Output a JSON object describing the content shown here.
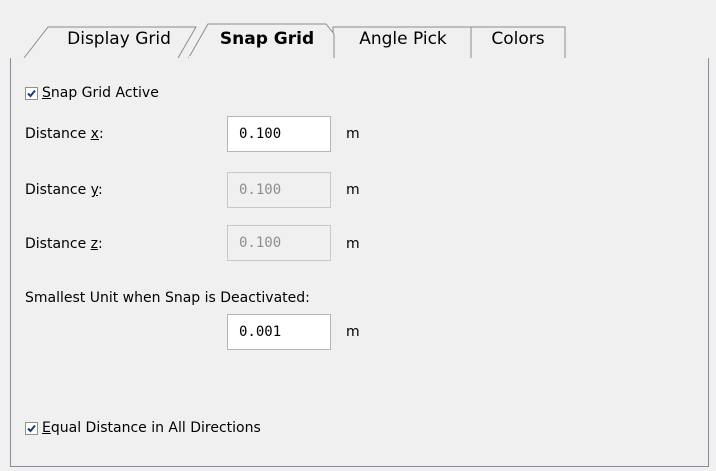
{
  "tabs": [
    {
      "label": "Display Grid",
      "active": false
    },
    {
      "label": "Snap Grid",
      "active": true
    },
    {
      "label": "Angle Pick",
      "active": false
    },
    {
      "label": "Colors",
      "active": false
    }
  ],
  "snap_grid_active": {
    "label_mnemonic": "S",
    "label_rest": "nap Grid Active",
    "checked": true
  },
  "distance_x": {
    "label_prefix": "Distance ",
    "mnemonic": "x",
    "label_suffix": ":",
    "value": "0.100",
    "unit": "m",
    "enabled": true
  },
  "distance_y": {
    "label_prefix": "Distance ",
    "mnemonic": "y",
    "label_suffix": ":",
    "value": "0.100",
    "unit": "m",
    "enabled": false
  },
  "distance_z": {
    "label_prefix": "Distance ",
    "mnemonic": "z",
    "label_suffix": ":",
    "value": "0.100",
    "unit": "m",
    "enabled": false
  },
  "smallest_unit": {
    "label": "Smallest Unit when Snap is Deactivated:",
    "value": "0.001",
    "unit": "m"
  },
  "equal_distance": {
    "label_mnemonic": "E",
    "label_rest": "qual Distance in All Directions",
    "checked": true
  },
  "colors": {
    "accent_check": "#1a3a78",
    "panel_bg": "#f0f0f0",
    "border": "#898c95",
    "disabled_text": "#8e8e8e"
  }
}
